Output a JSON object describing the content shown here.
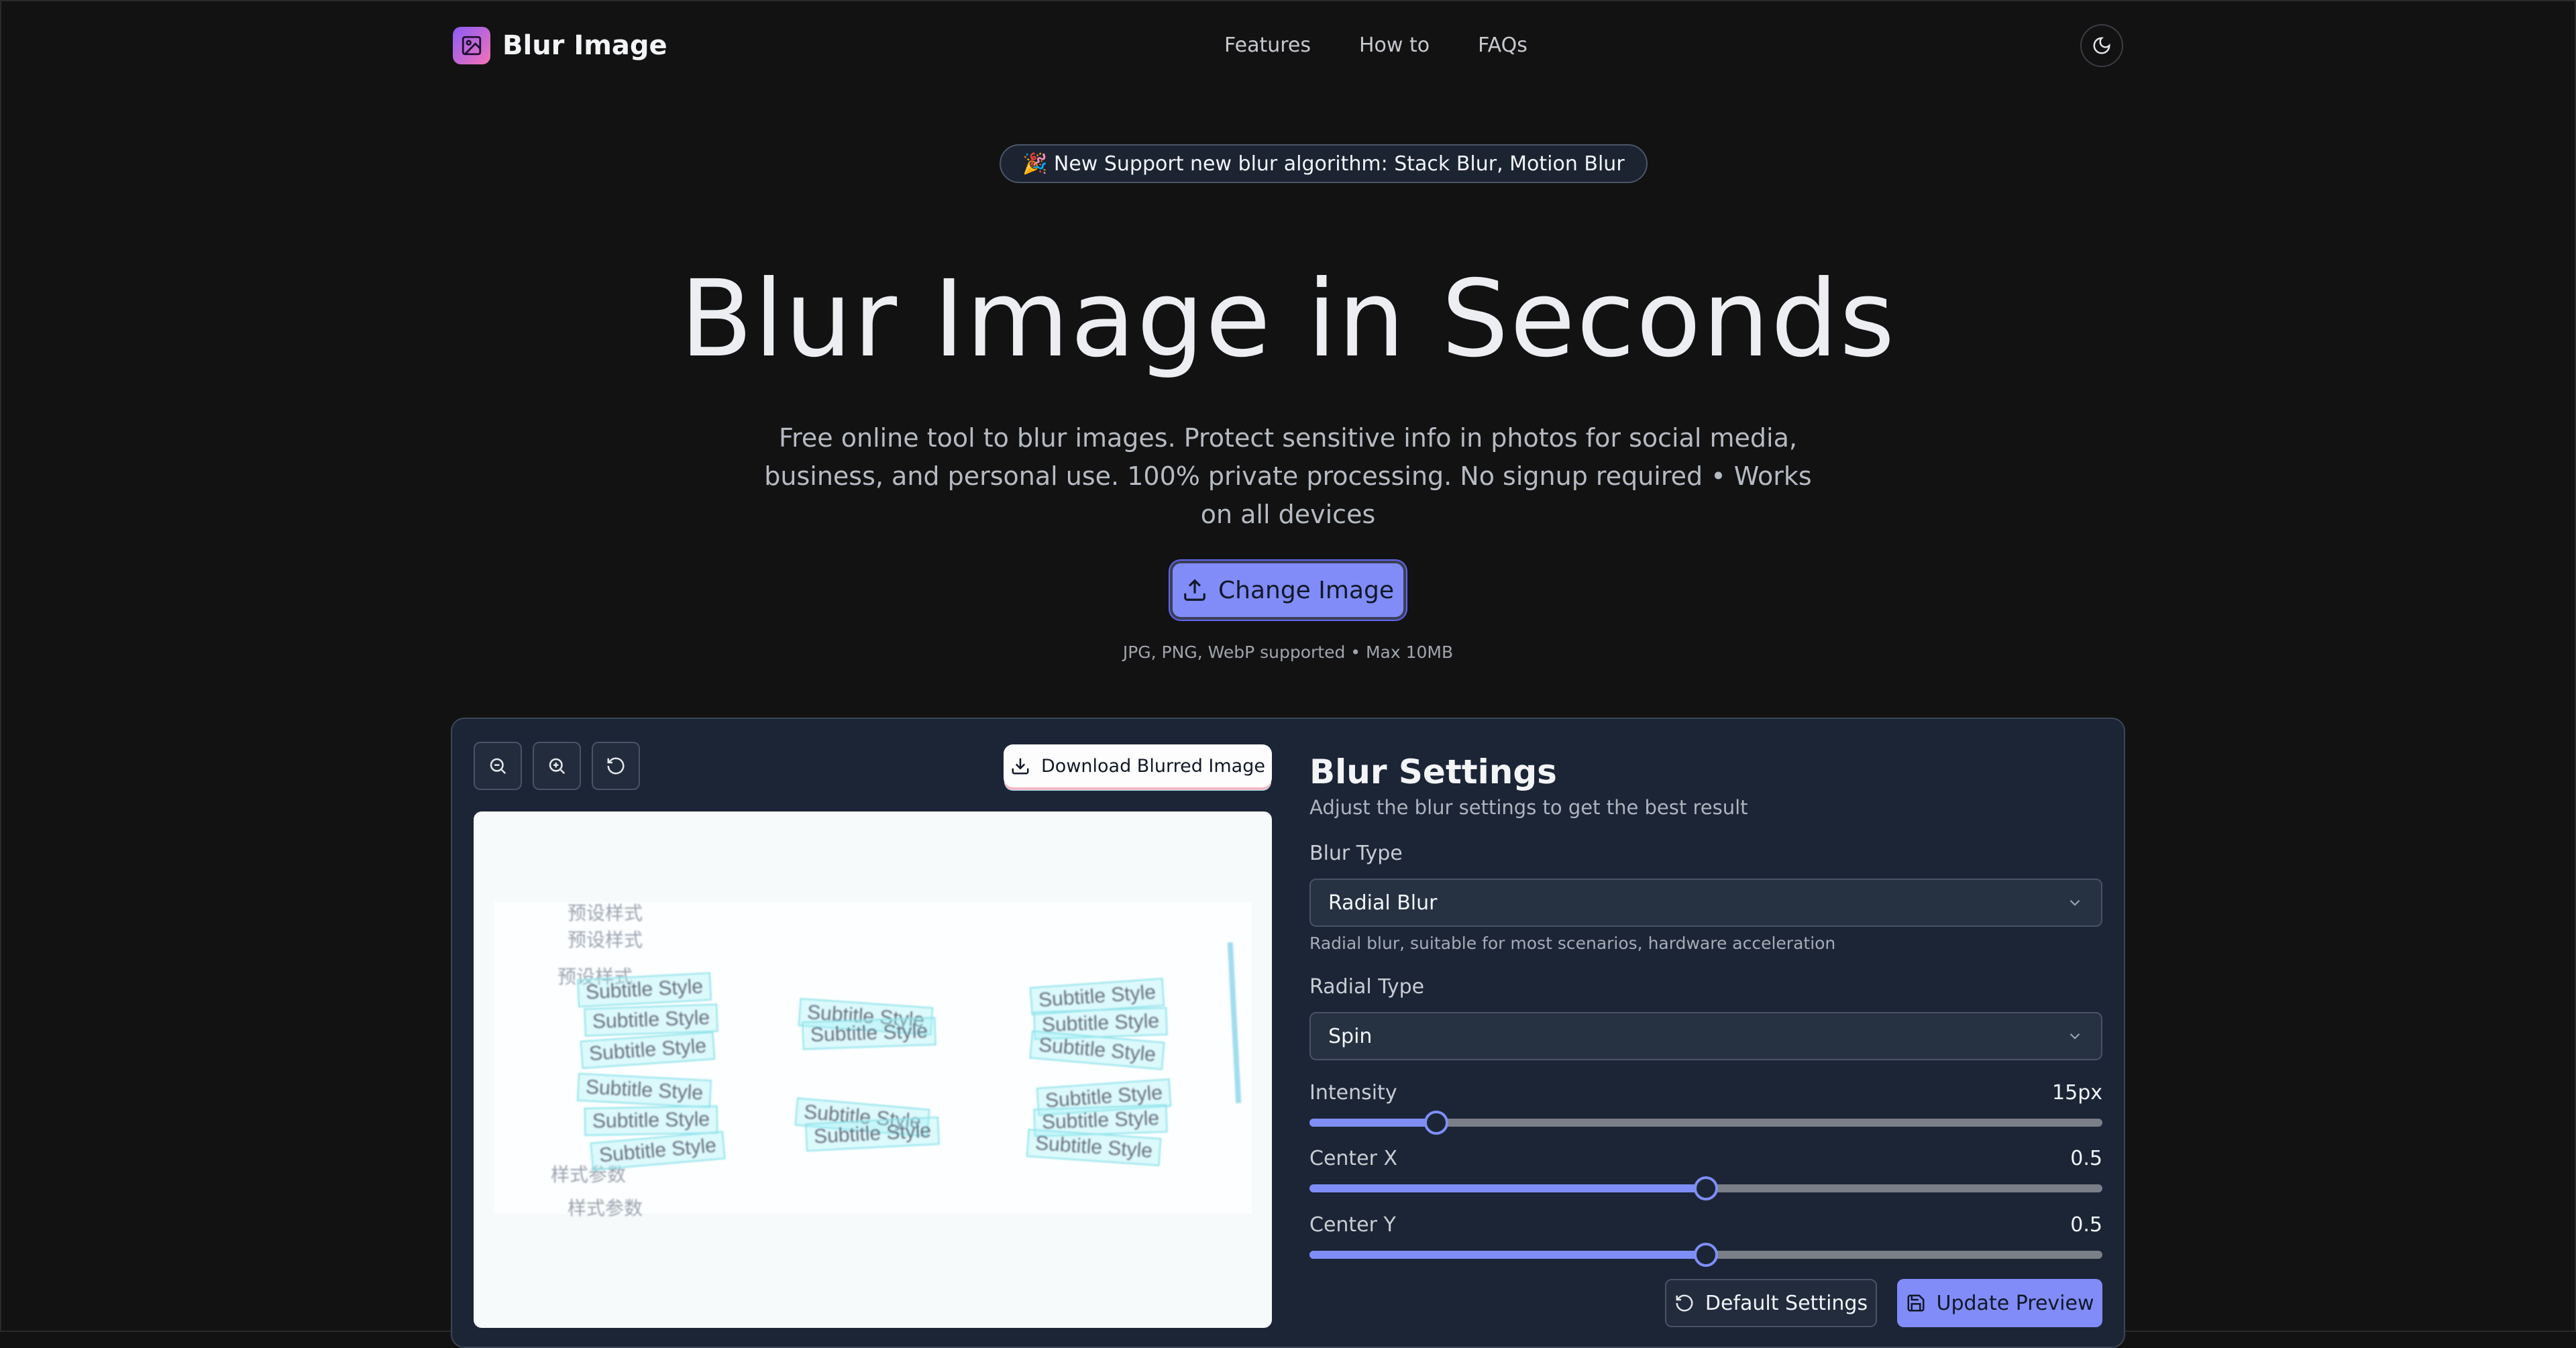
{
  "header": {
    "app_title": "Blur Image",
    "nav": [
      "Features",
      "How to",
      "FAQs"
    ]
  },
  "announcement": "🎉 New Support new blur algorithm: Stack Blur, Motion Blur",
  "hero": {
    "title": "Blur Image in Seconds",
    "subtitle": "Free online tool to blur images. Protect sensitive info in photos for social media, business, and personal use. 100% private processing. No signup required • Works on all devices",
    "change_button": "Change Image",
    "formats": "JPG, PNG, WebP supported • Max 10MB"
  },
  "toolbar": {
    "download_label": "Download Blurred Image"
  },
  "preview": {
    "card_text": "Subtitle Style",
    "cn_labels": [
      "预设样式",
      "预设样式",
      "预设样式",
      "样式参数",
      "样式参数"
    ]
  },
  "settings": {
    "title": "Blur Settings",
    "description": "Adjust the blur settings to get the best result",
    "blur_type_label": "Blur Type",
    "blur_type_value": "Radial Blur",
    "blur_type_hint": "Radial blur, suitable for most scenarios, hardware acceleration",
    "radial_type_label": "Radial Type",
    "radial_type_value": "Spin",
    "intensity_label": "Intensity",
    "intensity_value": "15px",
    "intensity_fraction": 0.16,
    "center_x_label": "Center X",
    "center_x_value": "0.5",
    "center_y_label": "Center Y",
    "center_y_value": "0.5",
    "default_button": "Default Settings",
    "update_button": "Update Preview"
  },
  "colors": {
    "background": "#121212",
    "panel": "#1b2536",
    "accent": "#818cf8"
  }
}
